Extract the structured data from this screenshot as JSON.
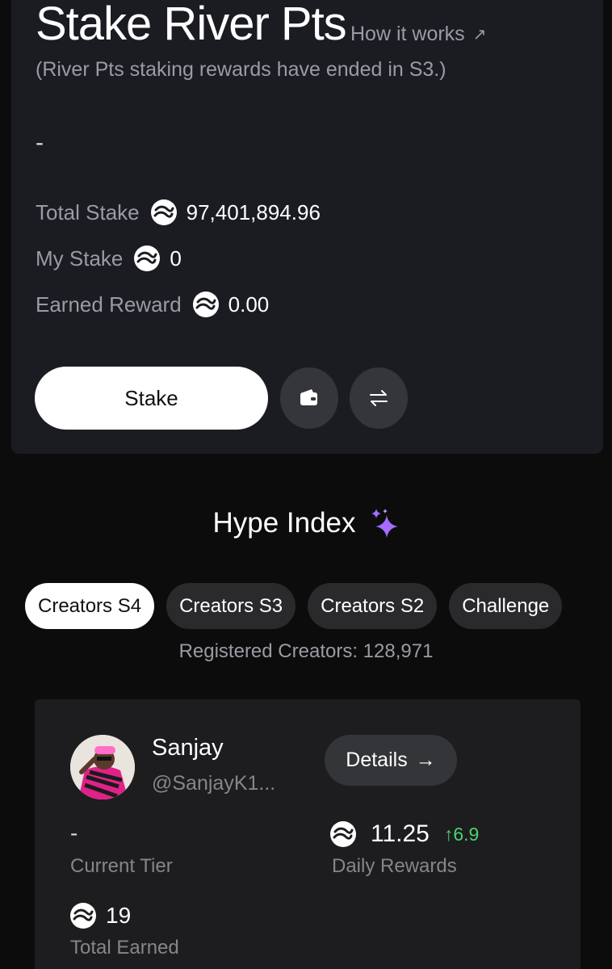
{
  "stake_panel": {
    "title": "Stake River Pts",
    "how_it_works": "How it works",
    "how_it_works_arrow": "↗",
    "subtitle": "(River Pts staking rewards have ended in S3.)",
    "apy_value": "-",
    "stats": {
      "total_stake_label": "Total Stake",
      "total_stake_value": "97,401,894.96",
      "my_stake_label": "My Stake",
      "my_stake_value": "0",
      "earned_reward_label": "Earned Reward",
      "earned_reward_value": "0.00"
    },
    "stake_button": "Stake",
    "icons": {
      "coin": "river-coin-icon",
      "wallet": "wallet-icon",
      "swap": "swap-arrows-icon"
    }
  },
  "hype_index": {
    "title": "Hype Index",
    "tabs": [
      {
        "label": "Creators S4",
        "active": true
      },
      {
        "label": "Creators S3",
        "active": false
      },
      {
        "label": "Creators S2",
        "active": false
      },
      {
        "label": "Challenge",
        "active": false
      }
    ],
    "registered_creators": "Registered Creators: 128,971"
  },
  "creator": {
    "name": "Sanjay",
    "handle": "@SanjayK1...",
    "details_button": "Details",
    "details_arrow": "→",
    "current_tier_value": "-",
    "current_tier_label": "Current Tier",
    "daily_rewards_value": "11.25",
    "daily_rewards_change": "↑6.9",
    "daily_rewards_label": "Daily Rewards",
    "total_earned_value": "19",
    "total_earned_label": "Total Earned"
  },
  "colors": {
    "accent_green": "#4ad26e",
    "sparkle": "#a66bff",
    "panel": "#1b1c22"
  }
}
